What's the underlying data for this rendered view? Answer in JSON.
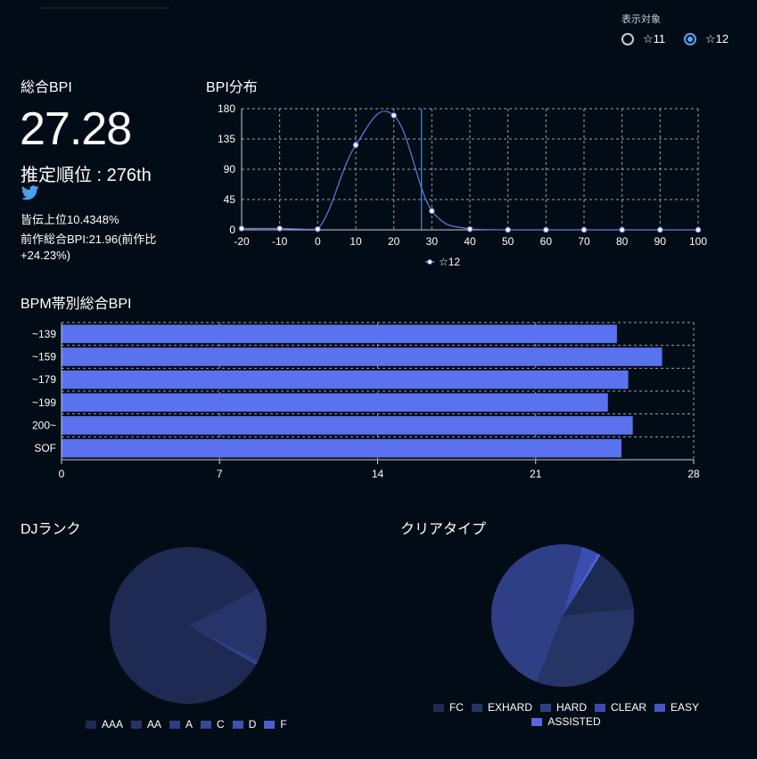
{
  "view_selector": {
    "label": "表示対象",
    "options": [
      {
        "label": "☆11",
        "checked": false
      },
      {
        "label": "☆12",
        "checked": true
      }
    ]
  },
  "total_bpi": {
    "title": "総合BPI",
    "value": "27.28",
    "rank_text": "推定順位 : 276th",
    "share_icon": "twitter-icon",
    "percentile_text": "皆伝上位10.4348%",
    "previous_text_1": "前作総合BPI:21.96(前作比",
    "previous_text_2": "+24.23%)"
  },
  "colors": {
    "background": "#020c17",
    "bar": "#5b72ef",
    "line": "#6b79e0",
    "accent": "#5aa4f5"
  },
  "bpi_distribution": {
    "title": "BPI分布",
    "chart_data": {
      "type": "line",
      "x": [
        -20,
        -10,
        0,
        10,
        20,
        30,
        40,
        50,
        60,
        70,
        80,
        90,
        100
      ],
      "series": [
        {
          "name": "☆12",
          "values": [
            2,
            2,
            1,
            126,
            170,
            28,
            1,
            0,
            0,
            0,
            0,
            0,
            0
          ]
        }
      ],
      "xlim": [
        -20,
        100
      ],
      "ylim": [
        0,
        180
      ],
      "xticks": [
        "-20",
        "-10",
        "0",
        "10",
        "20",
        "30",
        "40",
        "50",
        "60",
        "70",
        "80",
        "90",
        "100"
      ],
      "yticks": [
        "0",
        "45",
        "90",
        "135",
        "180"
      ],
      "marker_line_x": 27.28,
      "grid": true,
      "legend": "bottom"
    }
  },
  "bpm_chart": {
    "title": "BPM帯別総合BPI",
    "chart_data": {
      "type": "bar",
      "orientation": "horizontal",
      "categories": [
        "~139",
        "~159",
        "~179",
        "~199",
        "200~",
        "SOF"
      ],
      "values": [
        24.6,
        26.6,
        25.1,
        24.2,
        25.3,
        24.8
      ],
      "xlim": [
        0,
        28
      ],
      "xticks": [
        "0",
        "7",
        "14",
        "21",
        "28"
      ],
      "grid": true
    }
  },
  "dj_rank": {
    "title": "DJランク",
    "chart_data": {
      "type": "pie",
      "labels": [
        "AAA",
        "AA",
        "A",
        "C",
        "D",
        "F"
      ],
      "values": [
        84.0,
        15.0,
        0.6,
        0.2,
        0.1,
        0.1
      ],
      "colors": [
        "#1f2a52",
        "#26346a",
        "#2e3e82",
        "#36489a",
        "#3f53b3",
        "#4a5fcf"
      ],
      "legend": "bottom"
    }
  },
  "clear_type": {
    "title": "クリアタイプ",
    "chart_data": {
      "type": "pie",
      "labels": [
        "FC",
        "EXHARD",
        "HARD",
        "CLEAR",
        "EASY",
        "ASSISTED"
      ],
      "values": [
        14.5,
        32.5,
        48.5,
        3.5,
        0.5,
        0.5
      ],
      "colors": [
        "#1d2a52",
        "#263466",
        "#2e3f86",
        "#3a4db0",
        "#4356c4",
        "#5568e0"
      ],
      "legend": "bottom"
    }
  }
}
